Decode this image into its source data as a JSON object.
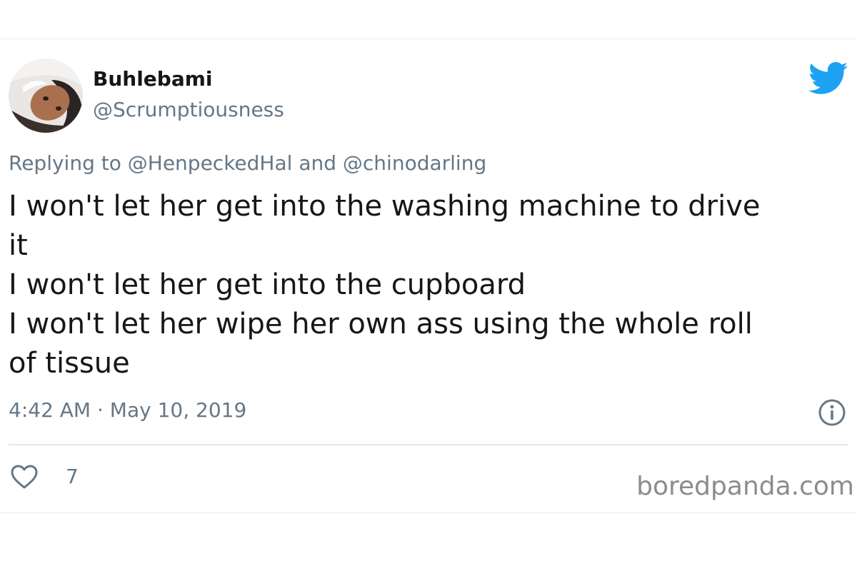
{
  "tweet": {
    "author": {
      "display_name": "Buhlebami",
      "handle": "@Scrumptiousness"
    },
    "reply": {
      "prefix": "Replying to",
      "mention_1": "@HenpeckedHal",
      "joiner": "and",
      "mention_2": "@chinodarling"
    },
    "body_lines": [
      "I won't let her get into the washing machine to drive",
      "it",
      "I won't let her get into the cupboard",
      "I won't let her wipe her own ass using the whole roll",
      "of tissue"
    ],
    "timestamp": "4:42 AM · May 10, 2019",
    "like_count": "7"
  },
  "icons": {
    "brand": "twitter-bird-icon",
    "info": "info-icon",
    "like": "heart-icon"
  },
  "colors": {
    "twitter_blue": "#1da1f2",
    "secondary_text": "#657786",
    "primary_text": "#14171a",
    "divider": "#e1e8ed"
  },
  "watermark": "boredpanda.com"
}
